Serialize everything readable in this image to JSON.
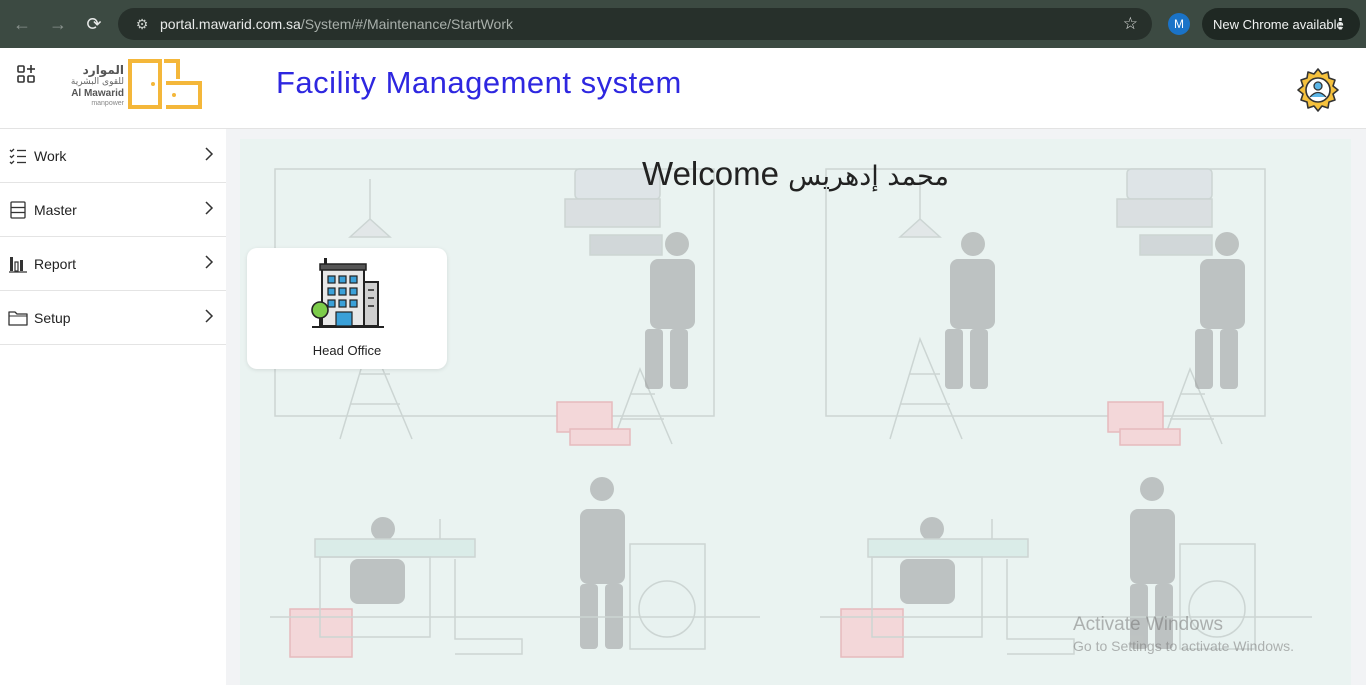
{
  "browser": {
    "url_host": "portal.mawarid.com.sa",
    "url_path": "/System/#/Maintenance/StartWork",
    "profile_initial": "M",
    "update_label": "New Chrome available"
  },
  "header": {
    "logo": {
      "arabic_line1": "الموارد",
      "arabic_line2": "للقوى البشرية",
      "english_line1": "Al Mawarid",
      "english_line2": "manpower",
      "accent_color": "#f4b73a"
    },
    "title": "Facility Management system",
    "title_color": "#2e27e0"
  },
  "sidebar": {
    "items": [
      {
        "label": "Work",
        "icon": "checklist-icon"
      },
      {
        "label": "Master",
        "icon": "server-icon"
      },
      {
        "label": "Report",
        "icon": "bar-chart-icon"
      },
      {
        "label": "Setup",
        "icon": "folder-icon"
      }
    ]
  },
  "main": {
    "welcome_prefix": "Welcome",
    "user_name": "محمد إدهريس",
    "cards": [
      {
        "label": "Head Office",
        "icon": "office-building-icon"
      }
    ]
  },
  "watermark": {
    "line1": "Activate Windows",
    "line2": "Go to Settings to activate Windows."
  }
}
